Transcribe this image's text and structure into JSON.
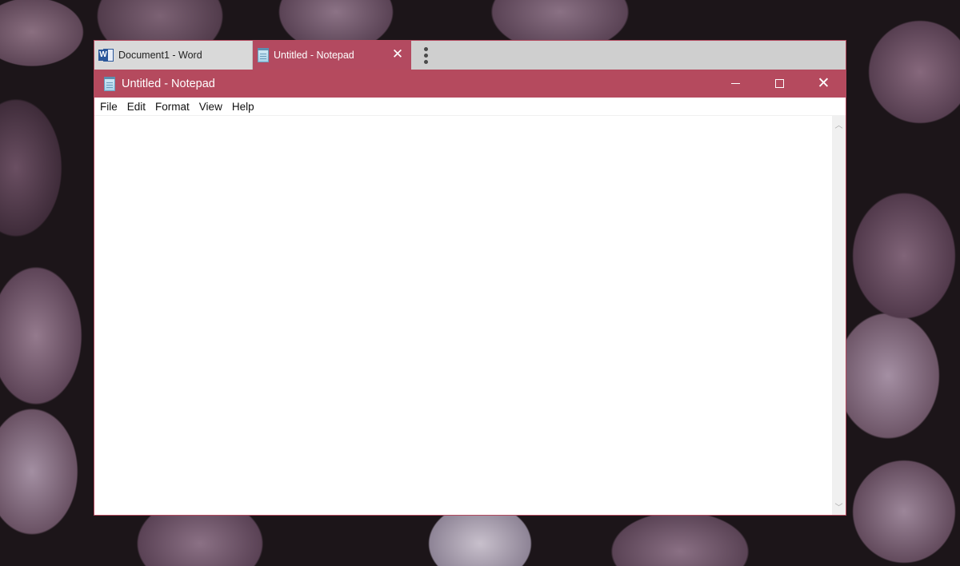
{
  "tabs": [
    {
      "label": "Document1 - Word",
      "icon": "word-icon",
      "active": false
    },
    {
      "label": "Untitled - Notepad",
      "icon": "notepad-icon",
      "active": true,
      "close": "✕"
    }
  ],
  "tab_overflow_icon": "more-vertical-icon",
  "window": {
    "title": "Untitled - Notepad",
    "accent_color": "#b54a5e",
    "caption_buttons": [
      "minimize",
      "maximize",
      "close"
    ]
  },
  "menu": {
    "items": [
      "File",
      "Edit",
      "Format",
      "View",
      "Help"
    ]
  },
  "editor": {
    "content": ""
  },
  "scrollbar": {
    "up_glyph": "︿",
    "down_glyph": "﹀"
  }
}
